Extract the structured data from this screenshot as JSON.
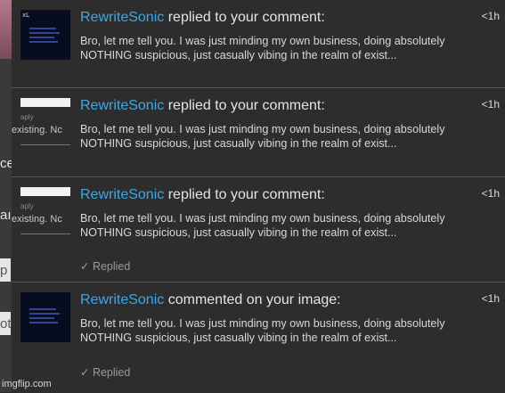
{
  "background_fragments": [
    "ce",
    "aı",
    "p",
    "ott"
  ],
  "notifications": [
    {
      "user": "RewriteSonic",
      "action": "replied to your comment:",
      "time": "<1h",
      "text": "Bro, let me tell you. I was just minding my own business, doing absolutely NOTHING suspicious, just casually vibing in the realm of exist...",
      "thumb": "dark",
      "thumb_corner": "xL",
      "replied": ""
    },
    {
      "user": "RewriteSonic",
      "action": "replied to your comment:",
      "time": "<1h",
      "text": "Bro, let me tell you. I was just minding my own business, doing absolutely NOTHING suspicious, just casually vibing in the realm of exist...",
      "thumb": "light",
      "thumb_small": "aply",
      "thumb_frag": "existing. Nc",
      "replied": ""
    },
    {
      "user": "RewriteSonic",
      "action": "replied to your comment:",
      "time": "<1h",
      "text": "Bro, let me tell you. I was just minding my own business, doing absolutely NOTHING suspicious, just casually vibing in the realm of exist...",
      "thumb": "light",
      "thumb_small": "aply",
      "thumb_frag": "existing. Nc",
      "replied": "✓ Replied"
    },
    {
      "user": "RewriteSonic",
      "action": "commented on your image:",
      "time": "<1h",
      "text": "Bro, let me tell you. I was just minding my own business, doing absolutely NOTHING suspicious, just casually vibing in the realm of exist...",
      "thumb": "dark",
      "thumb_corner": "",
      "replied": "✓ Replied"
    }
  ],
  "watermark": "imgflip.com",
  "colors": {
    "username": "#3ea8e5",
    "panel": "#2d2d2d",
    "divider": "#595959"
  }
}
